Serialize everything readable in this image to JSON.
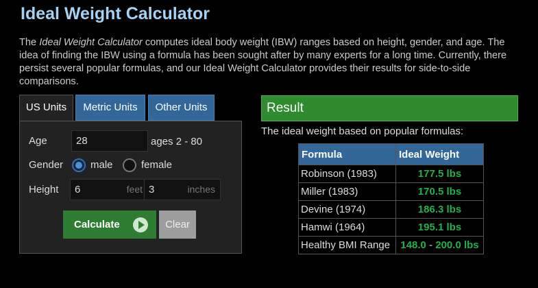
{
  "page": {
    "title": "Ideal Weight Calculator",
    "intro": {
      "pre": "The ",
      "em": "Ideal Weight Calculator",
      "post": " computes ideal body weight (IBW) ranges based on height, gender, and age. The idea of finding the IBW using a formula has been sought after by many experts for a long time. Currently, there persist several popular formulas, and our Ideal Weight Calculator provides their results for side-to-side comparisons."
    }
  },
  "tabs": [
    "US Units",
    "Metric Units",
    "Other Units"
  ],
  "form": {
    "age_label": "Age",
    "age_value": "28",
    "age_hint": "ages 2 - 80",
    "gender_label": "Gender",
    "gender_male": "male",
    "gender_female": "female",
    "gender_selected": "male",
    "height_label": "Height",
    "height_feet": "6",
    "height_feet_unit": "feet",
    "height_inches": "3",
    "height_inches_unit": "inches",
    "calculate": "Calculate",
    "clear": "Clear"
  },
  "result": {
    "heading": "Result",
    "subtitle": "The ideal weight based on popular formulas:",
    "columns": [
      "Formula",
      "Ideal Weight"
    ],
    "rows": [
      {
        "formula": "Robinson (1983)",
        "weight": "177.5 lbs"
      },
      {
        "formula": "Miller (1983)",
        "weight": "170.5 lbs"
      },
      {
        "formula": "Devine (1974)",
        "weight": "186.3 lbs"
      },
      {
        "formula": "Hamwi (1964)",
        "weight": "195.1 lbs"
      }
    ],
    "bmi_label": "Healthy BMI Range",
    "bmi_low": "148.0",
    "bmi_sep": " - ",
    "bmi_high": "200.0 lbs"
  },
  "colors": {
    "title": "#a5d1f2",
    "tab_blue": "#336699",
    "result_green": "#2e8b2e",
    "value_green": "#22b14c",
    "button_green": "#2e7d32"
  }
}
